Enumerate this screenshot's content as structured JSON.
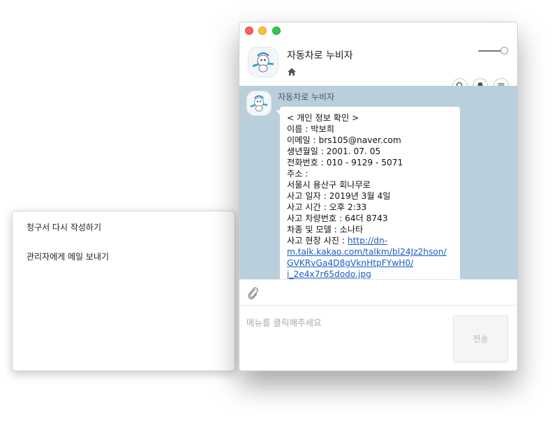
{
  "popup_menu": {
    "items": [
      {
        "label": "청구서 다시 작성하기"
      },
      {
        "label": "관리자에게 메일 보내기"
      }
    ]
  },
  "window": {
    "traffic_lights": {
      "close": "#fc605c",
      "minimize": "#fdbc40",
      "maximize": "#34c84a"
    },
    "header": {
      "title": "자동차로 누비자",
      "icons": [
        "home-icon",
        "search-icon",
        "bell-icon",
        "menu-icon"
      ]
    },
    "chat": {
      "background": "#bacfdc",
      "sender_name": "자동차로 누비자",
      "message_lines": [
        "< 개인 정보 확인 >",
        "이름 : 박보희",
        "이메일 : brs105@naver.com",
        "생년월일 : 2001. 07. 05",
        "전화번호 : 010 - 9129 - 5071",
        "주소 :",
        "서울시 용산구 회나무로",
        "사고 일자 : 2019년 3월 4일",
        "사고 시간 : 오후 2:33",
        "사고 차량번호 : 64더 8743",
        "차종 및 모델 : 소나타"
      ],
      "photo_label": "사고 현장 사진 : ",
      "photo_link_lines": [
        "http://dn-",
        "m.talk.kakao.com/talkm/bl24Jz2hson/",
        "GVKRvGa4D8gVknHtpFYwH0/",
        "i_2e4x7r65dodo.jpg"
      ]
    },
    "toolbar": {
      "attach_icon": "paperclip-icon"
    },
    "input": {
      "placeholder": "메뉴를 클릭해주세요",
      "send_label": "전송"
    }
  }
}
